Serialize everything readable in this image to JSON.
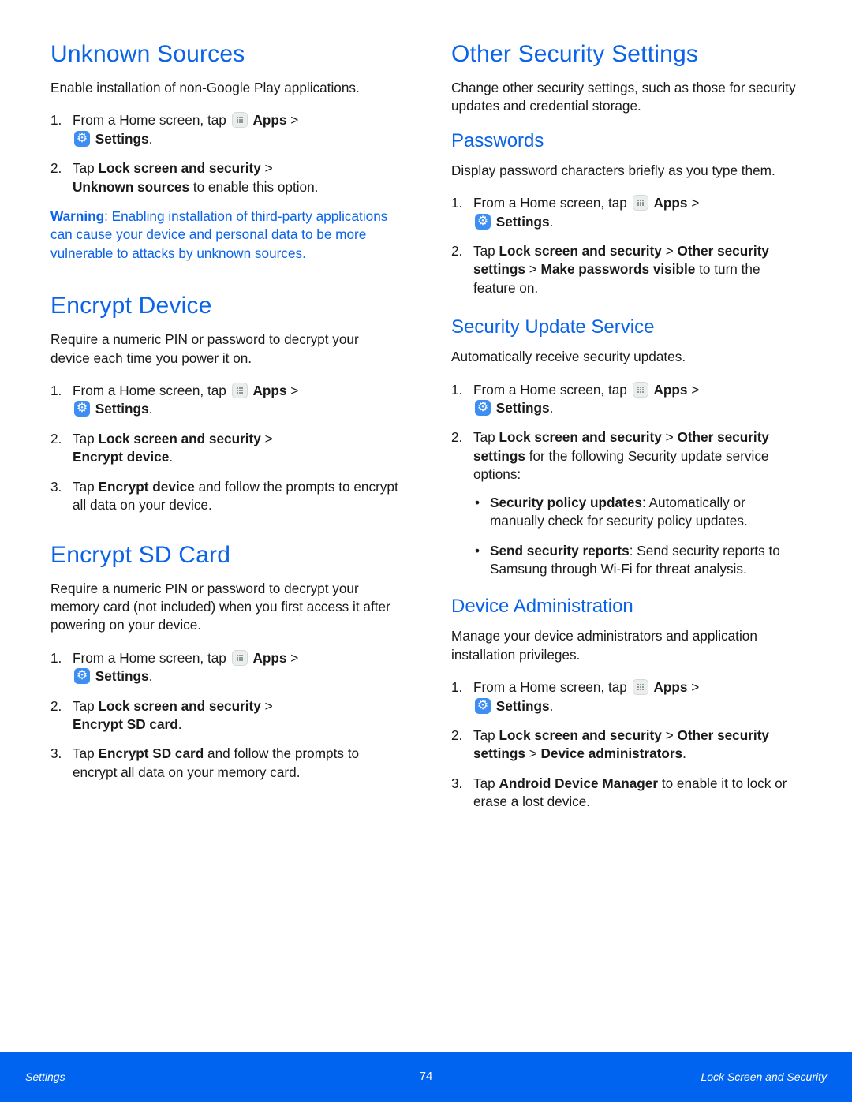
{
  "left": {
    "unknown_sources": {
      "title": "Unknown Sources",
      "intro": "Enable installation of non-Google Play applications.",
      "steps": [
        {
          "num": "1.",
          "pre": "From a Home screen, tap",
          "apps": "Apps",
          "sep": ">",
          "settings": "Settings",
          "end": "."
        },
        {
          "num": "2.",
          "pre": "Tap",
          "b1": "Lock screen and security",
          "sep": ">",
          "b2": "Unknown sources",
          "post": "to enable this option."
        }
      ],
      "warning_label": "Warning",
      "warning_text": ": Enabling installation of third-party applications can cause your device and personal data to be more vulnerable to attacks by unknown sources."
    },
    "encrypt_device": {
      "title": "Encrypt Device",
      "intro": "Require a numeric PIN or password to decrypt your device each time you power it on.",
      "steps": [
        {
          "num": "1.",
          "pre": "From a Home screen, tap",
          "apps": "Apps",
          "sep": ">",
          "settings": "Settings",
          "end": "."
        },
        {
          "num": "2.",
          "pre": "Tap",
          "b1": "Lock screen and security",
          "sep": ">",
          "b2": "Encrypt device",
          "end": "."
        },
        {
          "num": "3.",
          "pre": "Tap",
          "b1": "Encrypt device",
          "post": "and follow the prompts to encrypt all data on your device."
        }
      ]
    },
    "encrypt_sd": {
      "title": "Encrypt SD Card",
      "intro": "Require a numeric PIN or password to decrypt your memory card (not included) when you first access it after powering on your device.",
      "steps": [
        {
          "num": "1.",
          "pre": "From a Home screen, tap",
          "apps": "Apps",
          "sep": ">",
          "settings": "Settings",
          "end": "."
        },
        {
          "num": "2.",
          "pre": "Tap",
          "b1": "Lock screen and security",
          "sep": ">",
          "b2": "Encrypt SD card",
          "end": "."
        },
        {
          "num": "3.",
          "pre": "Tap",
          "b1": "Encrypt SD card",
          "post": "and follow the prompts to encrypt all data on your memory card."
        }
      ]
    }
  },
  "right": {
    "other": {
      "title": "Other Security Settings",
      "intro": "Change other security settings, such as those for security updates and credential storage."
    },
    "passwords": {
      "title": "Passwords",
      "intro": "Display password characters briefly as you type them.",
      "steps": [
        {
          "num": "1.",
          "pre": "From a Home screen, tap",
          "apps": "Apps",
          "sep": ">",
          "settings": "Settings",
          "end": "."
        },
        {
          "num": "2.",
          "pre": "Tap",
          "b1": "Lock screen and security",
          "sep1": ">",
          "b2": "Other security settings",
          "sep2": ">",
          "b3": "Make passwords visible",
          "post": "to turn the feature on."
        }
      ]
    },
    "update_service": {
      "title": "Security Update Service",
      "intro": "Automatically receive security updates.",
      "steps": [
        {
          "num": "1.",
          "pre": "From a Home screen, tap",
          "apps": "Apps",
          "sep": ">",
          "settings": "Settings",
          "end": "."
        },
        {
          "num": "2.",
          "pre": "Tap",
          "b1": "Lock screen and security",
          "sep": ">",
          "b2": "Other security settings",
          "post": "for the following Security update service options:"
        }
      ],
      "bullets": [
        {
          "bold": "Security policy updates",
          "text": ": Automatically or manually check for security policy updates."
        },
        {
          "bold": "Send security reports",
          "text": ": Send security reports to Samsung through Wi-Fi for threat analysis."
        }
      ]
    },
    "device_admin": {
      "title": "Device Administration",
      "intro": "Manage your device administrators and application installation privileges.",
      "steps": [
        {
          "num": "1.",
          "pre": "From a Home screen, tap",
          "apps": "Apps",
          "sep": ">",
          "settings": "Settings",
          "end": "."
        },
        {
          "num": "2.",
          "pre": "Tap",
          "b1": "Lock screen and security",
          "sep1": ">",
          "b2": "Other security settings",
          "sep2": ">",
          "b3": "Device administrators",
          "end": "."
        },
        {
          "num": "3.",
          "pre": "Tap",
          "b1": "Android Device Manager",
          "post": "to enable it to lock or erase a lost device."
        }
      ]
    }
  },
  "footer": {
    "left": "Settings",
    "page": "74",
    "right": "Lock Screen and Security"
  },
  "colors": {
    "heading": "#0a63e8",
    "footer_bg": "#0064f0"
  }
}
